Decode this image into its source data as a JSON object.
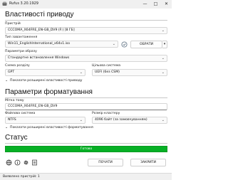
{
  "window": {
    "title": "Rufus 3.20.1929",
    "minimize_icon": "minimize-icon",
    "maximize_icon": "maximize-icon",
    "close_icon": "close-icon"
  },
  "drive_properties": {
    "heading": "Властивості приводу",
    "device_label": "Пристрій",
    "device_value": "CCCOMA_X64FRE_EN-GB_DV9 (F:) [8 ГБ]",
    "boot_type_label": "Тип завантаження",
    "boot_type_value": "Win11_EnglishInternational_x64v1.iso",
    "select_button": "ОБРАТИ",
    "image_option_label": "Параметри образу",
    "image_option_value": "Стандартне встановлення Windows",
    "partition_scheme_label": "Схема розділу",
    "partition_scheme_value": "GPT",
    "target_system_label": "Цільова система",
    "target_system_value": "UEFI (без CSM)",
    "advanced_toggle": "Показати розширені властивості приводу"
  },
  "format_options": {
    "heading": "Параметри форматування",
    "volume_label_label": "Мітка тому",
    "volume_label_value": "CCCOMA_X64FRE_EN-GB_DV9",
    "file_system_label": "Файлова система",
    "file_system_value": "NTFS",
    "cluster_size_label": "Розмір кластеру",
    "cluster_size_value": "4096 байт (за замовчуванням)",
    "advanced_toggle": "Показати розширені властивості форматування"
  },
  "status": {
    "heading": "Статус",
    "progress_text": "Готово",
    "progress_fraction": 1.0,
    "progress_color": "#06b025",
    "start_button": "ПОЧАТИ",
    "close_button": "ЗАКРИТИ"
  },
  "statusbar": {
    "text": "Виявлено пристрій: 1"
  }
}
